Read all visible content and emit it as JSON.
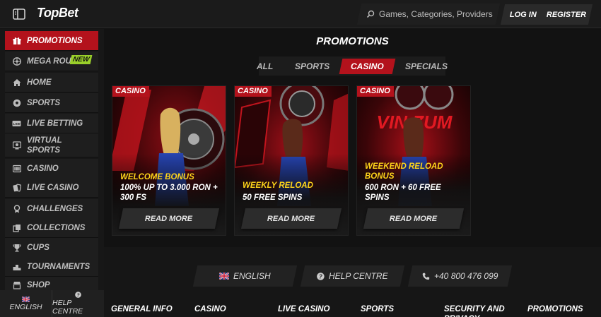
{
  "header": {
    "logo_top": "Top",
    "logo_bet": "Bet",
    "search_placeholder": "Games, Categories, Providers",
    "login_label": "LOG IN",
    "register_label": "REGISTER",
    "brand_red": "#b3121c"
  },
  "sidebar": {
    "items": [
      {
        "label": "PROMOTIONS",
        "icon": "gift-icon",
        "active": true
      },
      {
        "label": "MEGA ROU",
        "icon": "roulette-icon",
        "badge": "NEW"
      },
      {
        "label": "HOME",
        "icon": "home-icon"
      },
      {
        "label": "SPORTS",
        "icon": "soccer-ball-icon"
      },
      {
        "label": "LIVE BETTING",
        "icon": "live-icon"
      },
      {
        "label": "VIRTUAL SPORTS",
        "icon": "virtual-icon"
      },
      {
        "label": "CASINO",
        "icon": "slot-icon"
      },
      {
        "label": "LIVE CASINO",
        "icon": "cards-icon"
      },
      {
        "label": "CHALLENGES",
        "icon": "badge-icon"
      },
      {
        "label": "COLLECTIONS",
        "icon": "collection-icon"
      },
      {
        "label": "CUPS",
        "icon": "trophy-icon"
      },
      {
        "label": "TOURNAMENTS",
        "icon": "podium-icon"
      },
      {
        "label": "SHOP",
        "icon": "shop-icon"
      }
    ],
    "footer": {
      "language": "ENGLISH",
      "help": "HELP CENTRE"
    }
  },
  "main": {
    "title": "PROMOTIONS",
    "tabs": [
      {
        "label": "ALL"
      },
      {
        "label": "SPORTS"
      },
      {
        "label": "CASINO",
        "active": true
      },
      {
        "label": "SPECIALS"
      }
    ],
    "cards": [
      {
        "tag": "CASINO",
        "title": "WELCOME BONUS",
        "desc": "100% UP TO 3.000 RON + 300 FS",
        "cta": "READ MORE"
      },
      {
        "tag": "CASINO",
        "title": "WEEKLY RELOAD",
        "desc": "50 FREE SPINS",
        "cta": "READ MORE"
      },
      {
        "tag": "CASINO",
        "title": "WEEKEND RELOAD BONUS",
        "desc": "600 RON + 60 FREE SPINS",
        "cta": "READ MORE"
      }
    ]
  },
  "footer": {
    "language": "ENGLISH",
    "help": "HELP CENTRE",
    "phone": "+40 800 476 099",
    "columns": [
      "GENERAL INFO",
      "CASINO",
      "LIVE CASINO",
      "SPORTS",
      "SECURITY AND PRIVACY",
      "PROMOTIONS"
    ]
  }
}
